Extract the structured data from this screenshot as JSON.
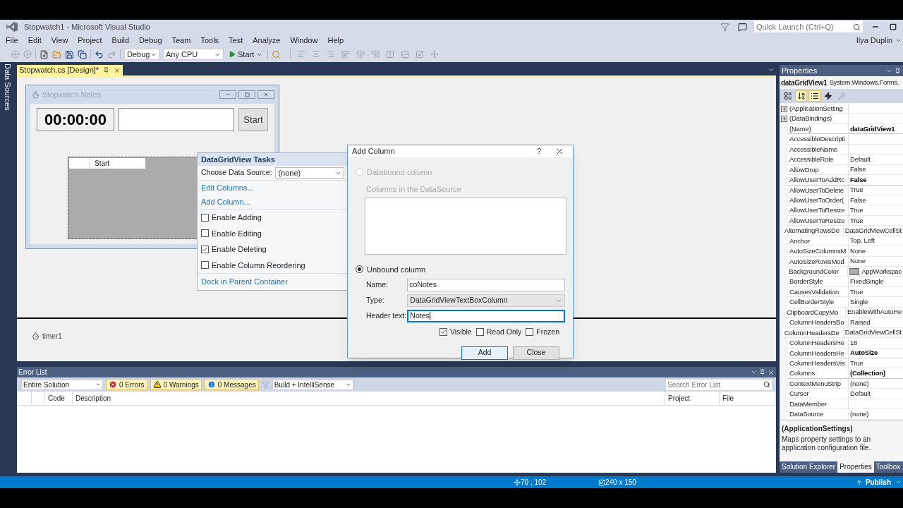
{
  "window": {
    "title": "Stopwatch1 - Microsoft Visual Studio"
  },
  "quick_launch": {
    "placeholder": "Quick Launch (Ctrl+Q)"
  },
  "menu": [
    "File",
    "Edit",
    "View",
    "Project",
    "Build",
    "Debug",
    "Team",
    "Tools",
    "Test",
    "Analyze",
    "Window",
    "Help"
  ],
  "user": "Ilya Duplin",
  "toolbar": {
    "configuration": "Debug",
    "platform": "Any CPU",
    "start": "Start"
  },
  "side_tab": "Data Sources",
  "document_tab": {
    "label": "Stopwatch.cs [Design]*"
  },
  "designer": {
    "form": {
      "title": "Stopwatch Notes",
      "time": "00:00:00",
      "button": "Start",
      "grid_column": "Start"
    },
    "tasks": {
      "title": "DataGridView Tasks",
      "data_source_label": "Choose Data Source:",
      "data_source": "(none)",
      "links": [
        "Edit Columns...",
        "Add Column..."
      ],
      "options": [
        {
          "label": "Enable Adding",
          "checked": false
        },
        {
          "label": "Enable Editing",
          "checked": false
        },
        {
          "label": "Enable Deleting",
          "checked": true
        },
        {
          "label": "Enable Column Reordering",
          "checked": false
        }
      ],
      "dock_link": "Dock in Parent Container"
    },
    "tray": [
      "timer1"
    ]
  },
  "dialog": {
    "title": "Add Column",
    "help": "?",
    "databound": {
      "label": "Databound column",
      "selected": false,
      "disabled": true
    },
    "columns_label": "Columns in the DataSource",
    "unbound": {
      "label": "Unbound column",
      "selected": true
    },
    "fields": [
      {
        "label": "Name:",
        "value": "coNotes",
        "kind": "text",
        "focused": false
      },
      {
        "label": "Type:",
        "value": "DataGridViewTextBoxColumn",
        "kind": "dropdown",
        "focused": false
      },
      {
        "label": "Header text:",
        "value": "Notes",
        "kind": "text",
        "focused": true
      }
    ],
    "options": [
      {
        "label": "Visible",
        "checked": true
      },
      {
        "label": "Read Only",
        "checked": false
      },
      {
        "label": "Frozen",
        "checked": false
      }
    ],
    "buttons": [
      {
        "label": "Add",
        "hovered": true
      },
      {
        "label": "Close",
        "hovered": false
      }
    ]
  },
  "error_list": {
    "title": "Error List",
    "scope": "Entire Solution",
    "filters": [
      {
        "label": "0 Errors",
        "kind": "error",
        "selected": true
      },
      {
        "label": "0 Warnings",
        "kind": "warning",
        "selected": true
      },
      {
        "label": "0 Messages",
        "kind": "message",
        "selected": true
      }
    ],
    "build_filter": "Build + IntelliSense",
    "search": {
      "placeholder": "Search Error List"
    },
    "columns": [
      "Code",
      "Description",
      "Project",
      "File"
    ]
  },
  "properties": {
    "title": "Properties",
    "object": "dataGridView1",
    "object_type": "System.Windows.Forms.",
    "view_buttons": [
      {
        "kind": "categorized",
        "selected": false
      },
      {
        "kind": "alphabetical",
        "selected": true
      },
      {
        "kind": "properties",
        "selected": true
      },
      {
        "kind": "events",
        "selected": false
      }
    ],
    "rows": [
      {
        "name": "(ApplicationSetting",
        "kind": "category",
        "modified": false
      },
      {
        "name": "(DataBindings)",
        "kind": "category",
        "modified": false
      },
      {
        "name": "(Name)",
        "value": "dataGridView1",
        "kind": "property",
        "modified": true
      },
      {
        "name": "AccessibleDescripti",
        "kind": "property",
        "modified": false
      },
      {
        "name": "AccessibleName",
        "kind": "property",
        "modified": false
      },
      {
        "name": "AccessibleRole",
        "value": "Default",
        "kind": "property",
        "modified": false
      },
      {
        "name": "AllowDrop",
        "value": "False",
        "kind": "property",
        "modified": false
      },
      {
        "name": "AllowUserToAddRc",
        "value": "False",
        "kind": "property",
        "modified": true
      },
      {
        "name": "AllowUserToDelete",
        "value": "True",
        "kind": "property",
        "modified": false
      },
      {
        "name": "AllowUserToOrder(",
        "value": "False",
        "kind": "property",
        "modified": false
      },
      {
        "name": "AllowUserToResize",
        "value": "True",
        "kind": "property",
        "modified": false
      },
      {
        "name": "AllowUserToResize",
        "value": "True",
        "kind": "property",
        "modified": false
      },
      {
        "name": "AlternatingRowsDe",
        "value": "DataGridViewCellSt",
        "kind": "property",
        "modified": false
      },
      {
        "name": "Anchor",
        "value": "Top, Left",
        "kind": "property",
        "modified": false
      },
      {
        "name": "AutoSizeColumnsM",
        "value": "None",
        "kind": "property",
        "modified": false
      },
      {
        "name": "AutoSizeRowsMod",
        "value": "None",
        "kind": "property",
        "modified": false
      },
      {
        "name": "BackgroundColor",
        "value": "AppWorkspac",
        "kind": "property",
        "modified": false,
        "color": "#ababab"
      },
      {
        "name": "BorderStyle",
        "value": "FixedSingle",
        "kind": "property",
        "modified": false
      },
      {
        "name": "CausesValidation",
        "value": "True",
        "kind": "property",
        "modified": false
      },
      {
        "name": "CellBorderStyle",
        "value": "Single",
        "kind": "property",
        "modified": false
      },
      {
        "name": "ClipboardCopyMo",
        "value": "EnableWithAutoHe",
        "kind": "property",
        "modified": false
      },
      {
        "name": "ColumnHeadersBo",
        "value": "Raised",
        "kind": "property",
        "modified": false
      },
      {
        "name": "ColumnHeadersDe",
        "value": "DataGridViewCellSt",
        "kind": "property",
        "modified": false
      },
      {
        "name": "ColumnHeadersHe",
        "value": "18",
        "kind": "property",
        "modified": false
      },
      {
        "name": "ColumnHeadersHe",
        "value": "AutoSize",
        "kind": "property",
        "modified": true
      },
      {
        "name": "ColumnHeadersVis",
        "value": "True",
        "kind": "property",
        "modified": false
      },
      {
        "name": "Columns",
        "value": "(Collection)",
        "kind": "property",
        "modified": true
      },
      {
        "name": "ContextMenuStrip",
        "value": "(none)",
        "kind": "property",
        "modified": false
      },
      {
        "name": "Cursor",
        "value": "Default",
        "kind": "property",
        "modified": false
      },
      {
        "name": "DataMember",
        "kind": "property",
        "modified": false
      },
      {
        "name": "DataSource",
        "value": "(none)",
        "kind": "property",
        "modified": false
      }
    ],
    "description": {
      "title": "(ApplicationSettings)",
      "text": "Maps property settings to an application configuration file."
    },
    "tabs": [
      {
        "label": "Solution Explorer",
        "selected": false
      },
      {
        "label": "Properties",
        "selected": true
      },
      {
        "label": "Toolbox",
        "selected": false
      }
    ]
  },
  "status_bar": {
    "position": "70 , 102",
    "size": "240 x 150",
    "publish": "Publish"
  }
}
